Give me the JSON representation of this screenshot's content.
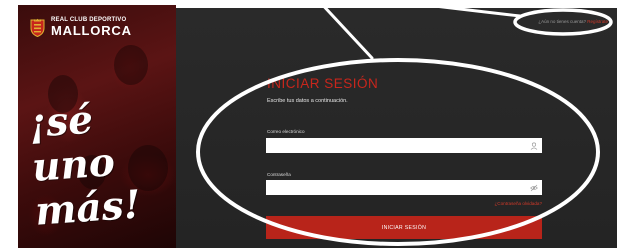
{
  "brand": {
    "club_line1": "REAL CLUB DEPORTIVO",
    "club_line2": "MALLORCA",
    "slogan_line1": "¡sé",
    "slogan_line2": "uno",
    "slogan_line3": "más!",
    "crest_colors": {
      "red": "#c8261c",
      "gold": "#e0b030"
    }
  },
  "header": {
    "signup_prompt": "¿Aún no tienes cuenta?",
    "signup_link": "Regístrate"
  },
  "login": {
    "title": "INICIAR SESIÓN",
    "subtitle": "Escribe tus datos a continuación.",
    "email_label": "Correo electrónico",
    "email_value": "",
    "email_icon": "user-icon",
    "password_label": "Contraseña",
    "password_value": "",
    "password_icon": "eye-slash-icon",
    "forgot_link": "¿Contraseña olvidada?",
    "submit_label": "INICIAR SESIÓN"
  },
  "colors": {
    "accent": "#c8261c",
    "panel_bg": "#262626",
    "annotation": "#ffffff"
  }
}
